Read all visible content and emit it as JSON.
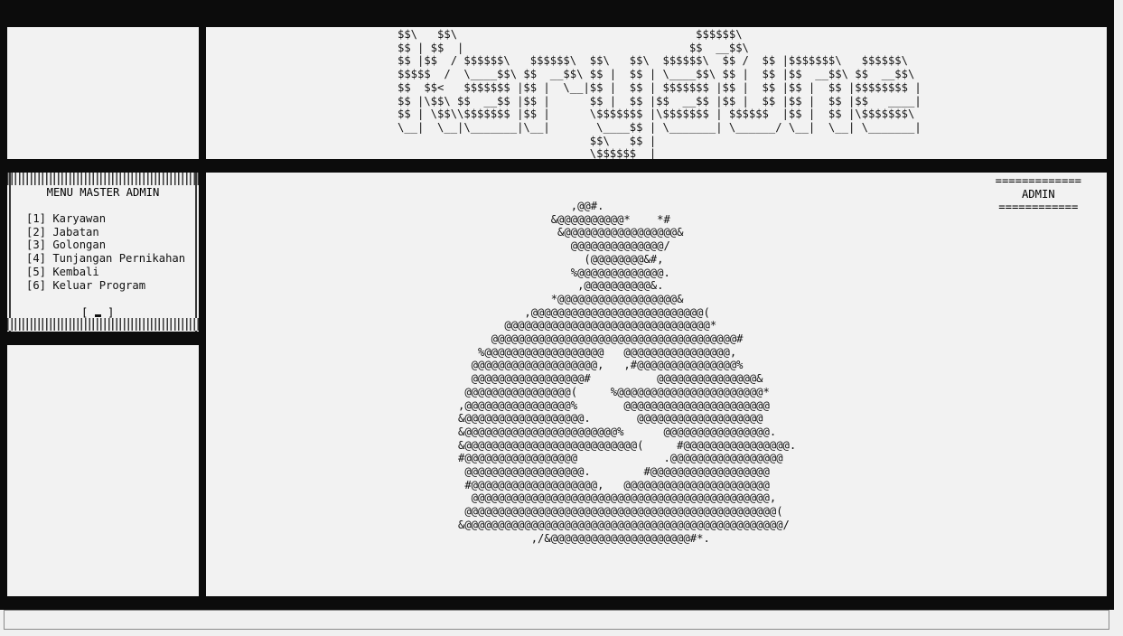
{
  "banner": {
    "ascii_title": "$$\\   $$\\                                    $$$$$$\\\n$$ | $$  |                                  $$  __$$\\\n$$ |$$  / $$$$$$\\   $$$$$$\\  $$\\   $$\\  $$$$$$\\  $$ /  $$ |$$$$$$$\\   $$$$$$\\\n$$$$$  /  \\____$$\\ $$  __$$\\ $$ |  $$ | \\____$$\\ $$ |  $$ |$$  __$$\\ $$  __$$\\\n$$  $$<   $$$$$$$ |$$ |  \\__|$$ |  $$ | $$$$$$$ |$$ |  $$ |$$ |  $$ |$$$$$$$$ |\n$$ |\\$$\\ $$  __$$ |$$ |      $$ |  $$ |$$  __$$ |$$ |  $$ |$$ |  $$ |$$   ____|\n$$ | \\$$\\\\$$$$$$$ |$$ |      \\$$$$$$$ |\\$$$$$$$ | $$$$$$  |$$ |  $$ |\\$$$$$$$\\\n\\__|  \\__|\\_______|\\__|       \\____$$ | \\_______| \\______/ \\__|  \\__| \\_______|\n                             $$\\   $$ |\n                             \\$$$$$$  |"
  },
  "menu": {
    "title": "MENU MASTER ADMIN",
    "items": [
      "[1] Karyawan",
      "[2] Jabatan",
      "[3] Golongan",
      "[4] Tunjangan Pernikahan",
      "[5] Kembali",
      "[6] Keluar Program"
    ],
    "prompt_open": "[ ",
    "prompt_close": " ]"
  },
  "role": {
    "rule_top": "=============",
    "label": "ADMIN",
    "rule_bottom": "============"
  },
  "art": {
    "money_bag": "                 ,@@#.\n              &@@@@@@@@@@*    *#\n               &@@@@@@@@@@@@@@@@@&\n                 @@@@@@@@@@@@@@/\n                   (@@@@@@@@&#,\n                 %@@@@@@@@@@@@@.\n                  ,@@@@@@@@@@&.\n              *@@@@@@@@@@@@@@@@@@&\n          ,@@@@@@@@@@@@@@@@@@@@@@@@@@(\n       @@@@@@@@@@@@@@@@@@@@@@@@@@@@@@@*\n     @@@@@@@@@@@@@@@@@@@@@@@@@@@@@@@@@@@@@#\n   %@@@@@@@@@@@@@@@@@@   @@@@@@@@@@@@@@@@,\n  @@@@@@@@@@@@@@@@@@@,   ,#@@@@@@@@@@@@@@@%\n  @@@@@@@@@@@@@@@@@#          @@@@@@@@@@@@@@@&\n @@@@@@@@@@@@@@@@(     %@@@@@@@@@@@@@@@@@@@@@@*\n,@@@@@@@@@@@@@@@@%       @@@@@@@@@@@@@@@@@@@@@@\n&@@@@@@@@@@@@@@@@@@.       @@@@@@@@@@@@@@@@@@@\n&@@@@@@@@@@@@@@@@@@@@@@@%      @@@@@@@@@@@@@@@@.\n&@@@@@@@@@@@@@@@@@@@@@@@@@@(     #@@@@@@@@@@@@@@@@.\n#@@@@@@@@@@@@@@@@@             .@@@@@@@@@@@@@@@@@\n @@@@@@@@@@@@@@@@@@.        #@@@@@@@@@@@@@@@@@@\n #@@@@@@@@@@@@@@@@@@@,   @@@@@@@@@@@@@@@@@@@@@@\n  @@@@@@@@@@@@@@@@@@@@@@@@@@@@@@@@@@@@@@@@@@@@@,\n @@@@@@@@@@@@@@@@@@@@@@@@@@@@@@@@@@@@@@@@@@@@@@@(\n&@@@@@@@@@@@@@@@@@@@@@@@@@@@@@@@@@@@@@@@@@@@@@@@@/\n           ,/&@@@@@@@@@@@@@@@@@@@@@#*."
  }
}
